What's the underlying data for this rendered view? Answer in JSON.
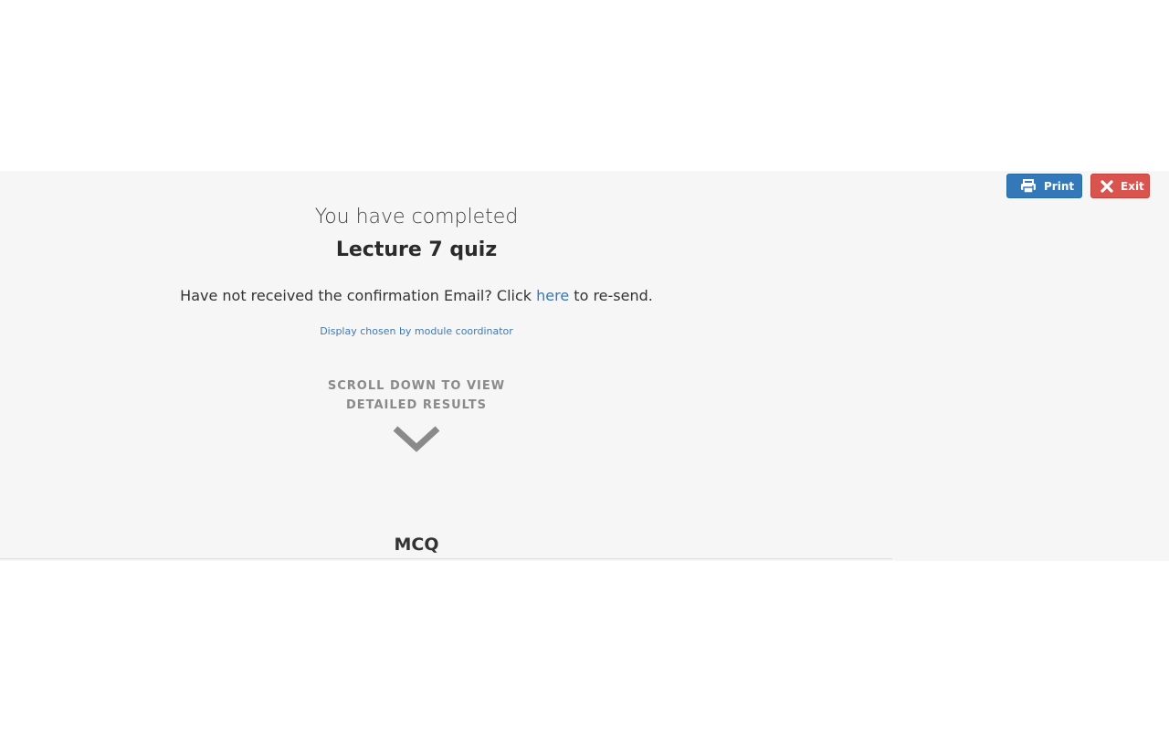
{
  "toolbar": {
    "print_label": "Print",
    "print_icon": "printer-icon",
    "exit_label": "Exit",
    "exit_icon": "close-icon",
    "print_color": "#3378b9",
    "exit_color": "#d9534f"
  },
  "completion": {
    "heading": "You have completed",
    "quiz_title": "Lecture 7 quiz",
    "email_prefix": "Have not received the confirmation Email? Click ",
    "email_link": "here",
    "email_suffix": " to re-send.",
    "display_note": "Display chosen by module coordinator",
    "scroll_hint_line1": "SCROLL DOWN TO VIEW",
    "scroll_hint_line2": "DETAILED RESULTS",
    "scroll_icon": "chevron-down-icon"
  },
  "results": {
    "section_heading": "MCQ"
  }
}
